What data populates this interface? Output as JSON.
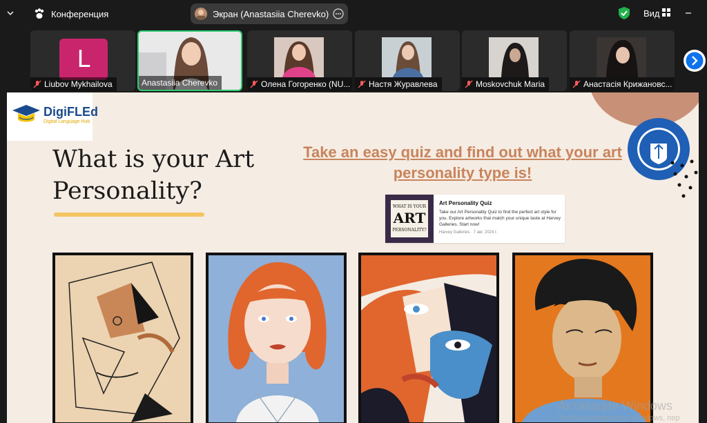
{
  "topbar": {
    "meeting_label": "Конференция",
    "share_label": "Экран (Anastasiia Cherevko)",
    "view_label": "Вид"
  },
  "participants": [
    {
      "name": "Liubov Mykhailova",
      "initial": "L",
      "muted": true
    },
    {
      "name": "Anastasiia Cherevko",
      "muted": false,
      "active": true
    },
    {
      "name": "Олена Гогоренко (NU...",
      "muted": true
    },
    {
      "name": "Настя Журавлева",
      "muted": true
    },
    {
      "name": "Moskovchuk Maria",
      "muted": true
    },
    {
      "name": "Анастасія Крижановс...",
      "muted": true
    }
  ],
  "slide": {
    "logo_title": "DigiFLEd",
    "logo_subtitle": "Digital Language Hub",
    "headline": "What is your Art Personality?",
    "quiz_link": "Take an easy quiz and find out what your art personality type is!",
    "card": {
      "thumb_line1": "WHAT IS YOUR",
      "thumb_line2": "ART",
      "thumb_line3": "PERSONALITY?",
      "title": "Art Personality Quiz",
      "description": "Take our Art Personality Quiz to find the perfect art style for you. Explore artworks that match your unique taste at Harvey Galleries. Start now!",
      "source": "Harvey Galleries · 7 авг. 2024 г."
    }
  },
  "watermark": {
    "line1": "Активация Windows",
    "line2": "Чтобы активировать Windows, пер"
  },
  "colors": {
    "active_border": "#2ecc71",
    "slide_bg": "#f5ece3",
    "link": "#c8845c",
    "accent_yellow": "#f2c462"
  }
}
